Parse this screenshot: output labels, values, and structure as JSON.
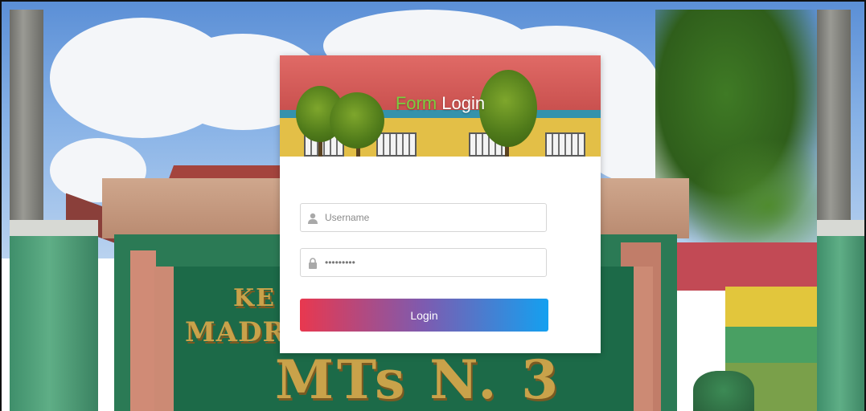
{
  "login": {
    "title_accent": "Form",
    "title_main": "Login",
    "username": {
      "placeholder": "Username",
      "value": ""
    },
    "password": {
      "placeholder": "",
      "value": "•••••••••"
    },
    "submit_label": "Login"
  },
  "background_sign": {
    "line1": "KE",
    "line2": "MADRA",
    "line3": "MTs N. 3"
  },
  "icons": {
    "username": "user-icon",
    "password": "lock-icon"
  },
  "colors": {
    "accent_green": "#7bcf3f",
    "button_start": "#e8384f",
    "button_end": "#14a0f0"
  }
}
